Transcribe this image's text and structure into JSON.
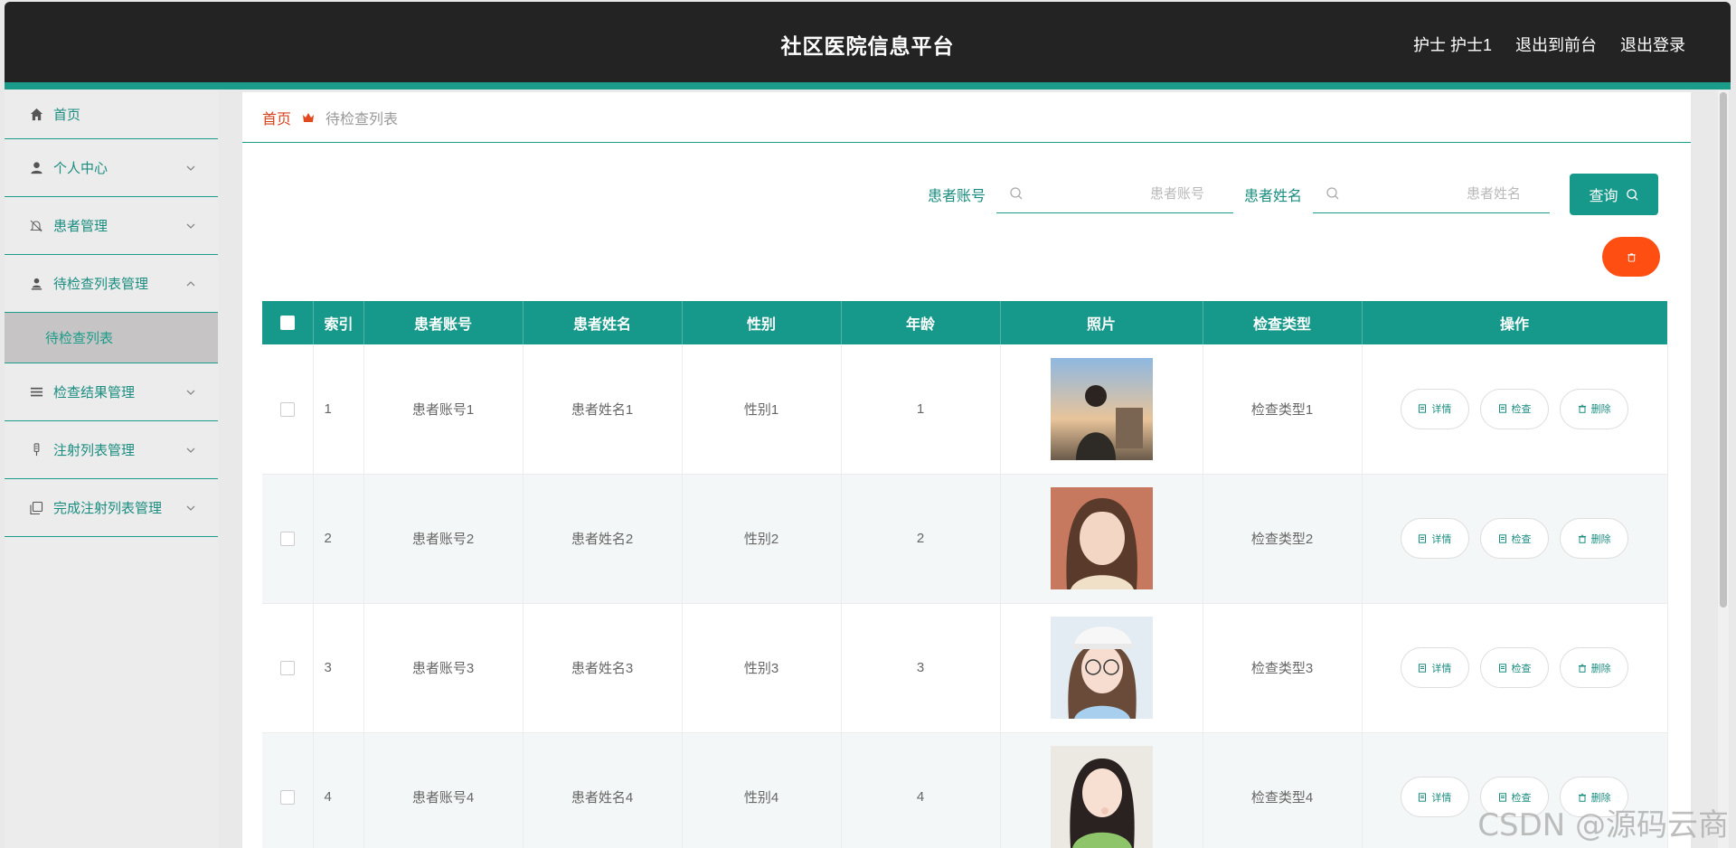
{
  "header": {
    "title": "社区医院信息平台",
    "user": "护士 护士1",
    "frontend_link": "退出到前台",
    "logout_link": "退出登录"
  },
  "sidebar": {
    "items": [
      {
        "label": "首页",
        "icon": "home-icon"
      },
      {
        "label": "个人中心",
        "icon": "user-icon"
      },
      {
        "label": "患者管理",
        "icon": "bell-off-icon"
      },
      {
        "label": "待检查列表管理",
        "icon": "user-stand-icon"
      },
      {
        "label": "检查结果管理",
        "icon": "list-icon"
      },
      {
        "label": "注射列表管理",
        "icon": "syringe-icon"
      },
      {
        "label": "完成注射列表管理",
        "icon": "copy-icon"
      }
    ],
    "submenu_label": "待检查列表"
  },
  "breadcrumb": {
    "home": "首页",
    "current": "待检查列表"
  },
  "search": {
    "account_label": "患者账号",
    "account_placeholder": "患者账号",
    "name_label": "患者姓名",
    "name_placeholder": "患者姓名",
    "button_label": "查询"
  },
  "table": {
    "headers": {
      "index": "索引",
      "account": "患者账号",
      "name": "患者姓名",
      "gender": "性别",
      "age": "年龄",
      "photo": "照片",
      "check_type": "检查类型",
      "ops": "操作"
    },
    "rows": [
      {
        "index": "1",
        "account": "患者账号1",
        "name": "患者姓名1",
        "gender": "性别1",
        "age": "1",
        "check_type": "检查类型1"
      },
      {
        "index": "2",
        "account": "患者账号2",
        "name": "患者姓名2",
        "gender": "性别2",
        "age": "2",
        "check_type": "检查类型2"
      },
      {
        "index": "3",
        "account": "患者账号3",
        "name": "患者姓名3",
        "gender": "性别3",
        "age": "3",
        "check_type": "检查类型3"
      },
      {
        "index": "4",
        "account": "患者账号4",
        "name": "患者姓名4",
        "gender": "性别4",
        "age": "4",
        "check_type": "检查类型4"
      }
    ],
    "actions": {
      "detail": "详情",
      "check": "检查",
      "delete": "删除"
    }
  },
  "watermark": "CSDN @源码云商",
  "colors": {
    "accent": "#16998a",
    "header_bg": "#232323",
    "danger": "#ff4e12",
    "breadcrumb_home": "#d5431d"
  }
}
